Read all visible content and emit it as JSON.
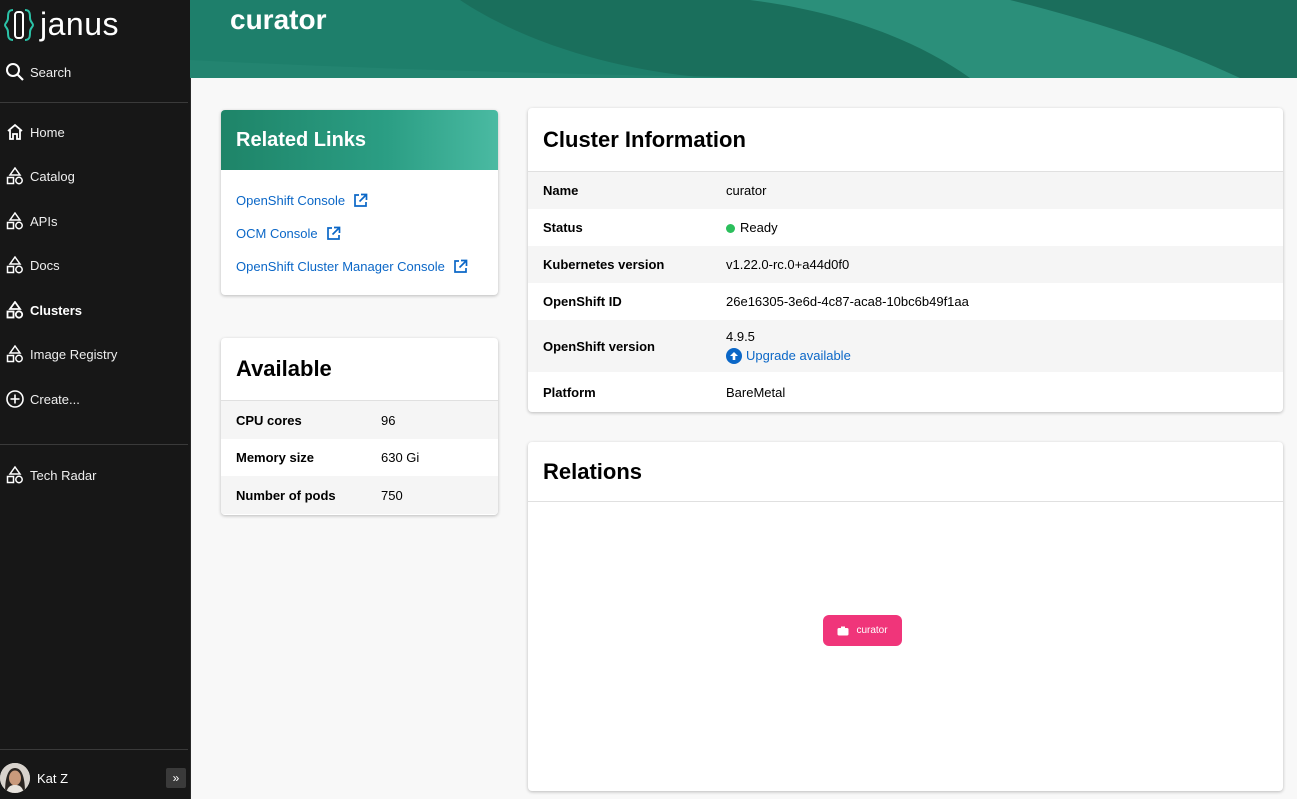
{
  "sidebar": {
    "brand": "janus",
    "search_label": "Search",
    "items": [
      {
        "label": "Home",
        "icon": "home-icon"
      },
      {
        "label": "Catalog",
        "icon": "shapes-icon"
      },
      {
        "label": "APIs",
        "icon": "shapes-icon"
      },
      {
        "label": "Docs",
        "icon": "shapes-icon"
      },
      {
        "label": "Clusters",
        "icon": "shapes-icon",
        "active": true
      },
      {
        "label": "Image Registry",
        "icon": "shapes-icon"
      },
      {
        "label": "Create...",
        "icon": "add-circle-icon"
      }
    ],
    "secondary_items": [
      {
        "label": "Tech Radar",
        "icon": "shapes-icon"
      }
    ],
    "user_name": "Kat Z",
    "collapse_glyph": "»"
  },
  "header": {
    "title": "curator"
  },
  "related_links": {
    "title": "Related Links",
    "links": [
      "OpenShift Console",
      "OCM Console",
      "OpenShift Cluster Manager Console"
    ]
  },
  "available": {
    "title": "Available",
    "rows": [
      {
        "label": "CPU cores",
        "value": "96"
      },
      {
        "label": "Memory size",
        "value": "630 Gi"
      },
      {
        "label": "Number of pods",
        "value": "750"
      }
    ]
  },
  "cluster_info": {
    "title": "Cluster Information",
    "rows": [
      {
        "label": "Name",
        "value": "curator"
      },
      {
        "label": "Status",
        "value": "Ready"
      },
      {
        "label": "Kubernetes version",
        "value": "v1.22.0-rc.0+a44d0f0"
      },
      {
        "label": "OpenShift ID",
        "value": "26e16305-3e6d-4c87-aca8-10bc6b49f1aa"
      },
      {
        "label": "OpenShift version",
        "value": "4.9.5",
        "extra": "Upgrade available"
      },
      {
        "label": "Platform",
        "value": "BareMetal"
      }
    ]
  },
  "relations": {
    "title": "Relations",
    "node_label": "curator"
  },
  "colors": {
    "accent": "#1f7f6c",
    "link": "#0b67c7",
    "ready": "#2bbf5c",
    "node": "#f0357a"
  }
}
